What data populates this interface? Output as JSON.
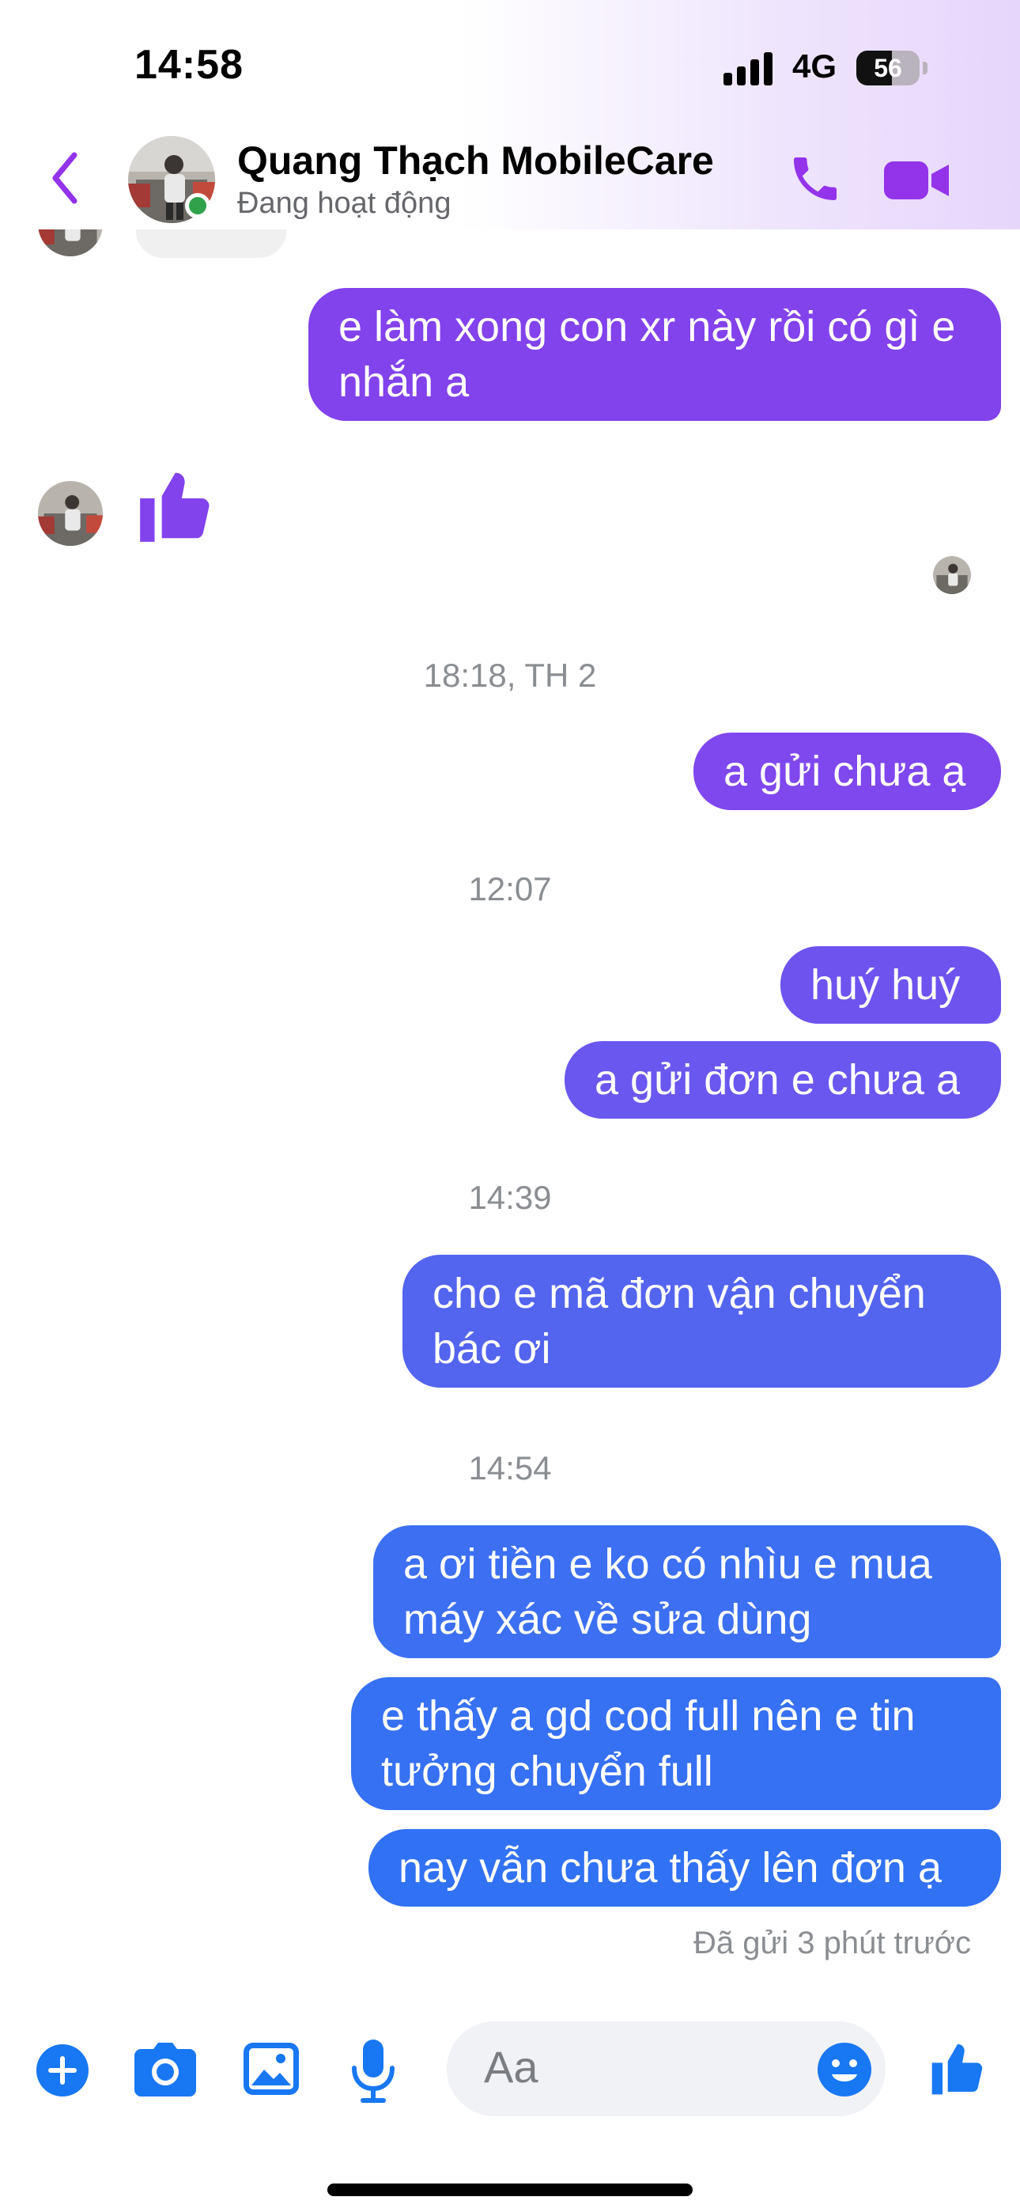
{
  "status_bar": {
    "time": "14:58",
    "network": "4G",
    "battery": "56",
    "battery_level": 0.56
  },
  "header": {
    "contact_name": "Quang Thạch MobileCare",
    "contact_status": "Đang hoạt động",
    "icons": [
      "back-chevron-icon",
      "phone-icon",
      "video-camera-icon"
    ],
    "accent_color": "#9333ea"
  },
  "messages": {
    "m1": "e làm xong con xr này rồi có gì e nhắn a",
    "ts1": "18:18, TH 2",
    "m2": "a gửi chưa ạ",
    "ts2": "12:07",
    "m3": "huý huý",
    "m4": "a gửi đơn e chưa a",
    "ts3": "14:39",
    "m5": "cho e mã đơn vận chuyển bác ơi",
    "ts4": "14:54",
    "m6": "a ơi tiền e ko có nhìu e mua máy xác về sửa dùng",
    "m7": "e thấy a gd cod full nên e tin tưởng chuyển full",
    "m8": "nay vẫn chưa thấy lên đơn ạ",
    "sent_status": "Đã gửi 3 phút trước"
  },
  "composer": {
    "placeholder": "Aa",
    "icons": [
      "plus-icon",
      "camera-icon",
      "image-icon",
      "microphone-icon",
      "emoji-icon",
      "thumbs-up-icon"
    ],
    "accent_color": "#1877f2"
  }
}
